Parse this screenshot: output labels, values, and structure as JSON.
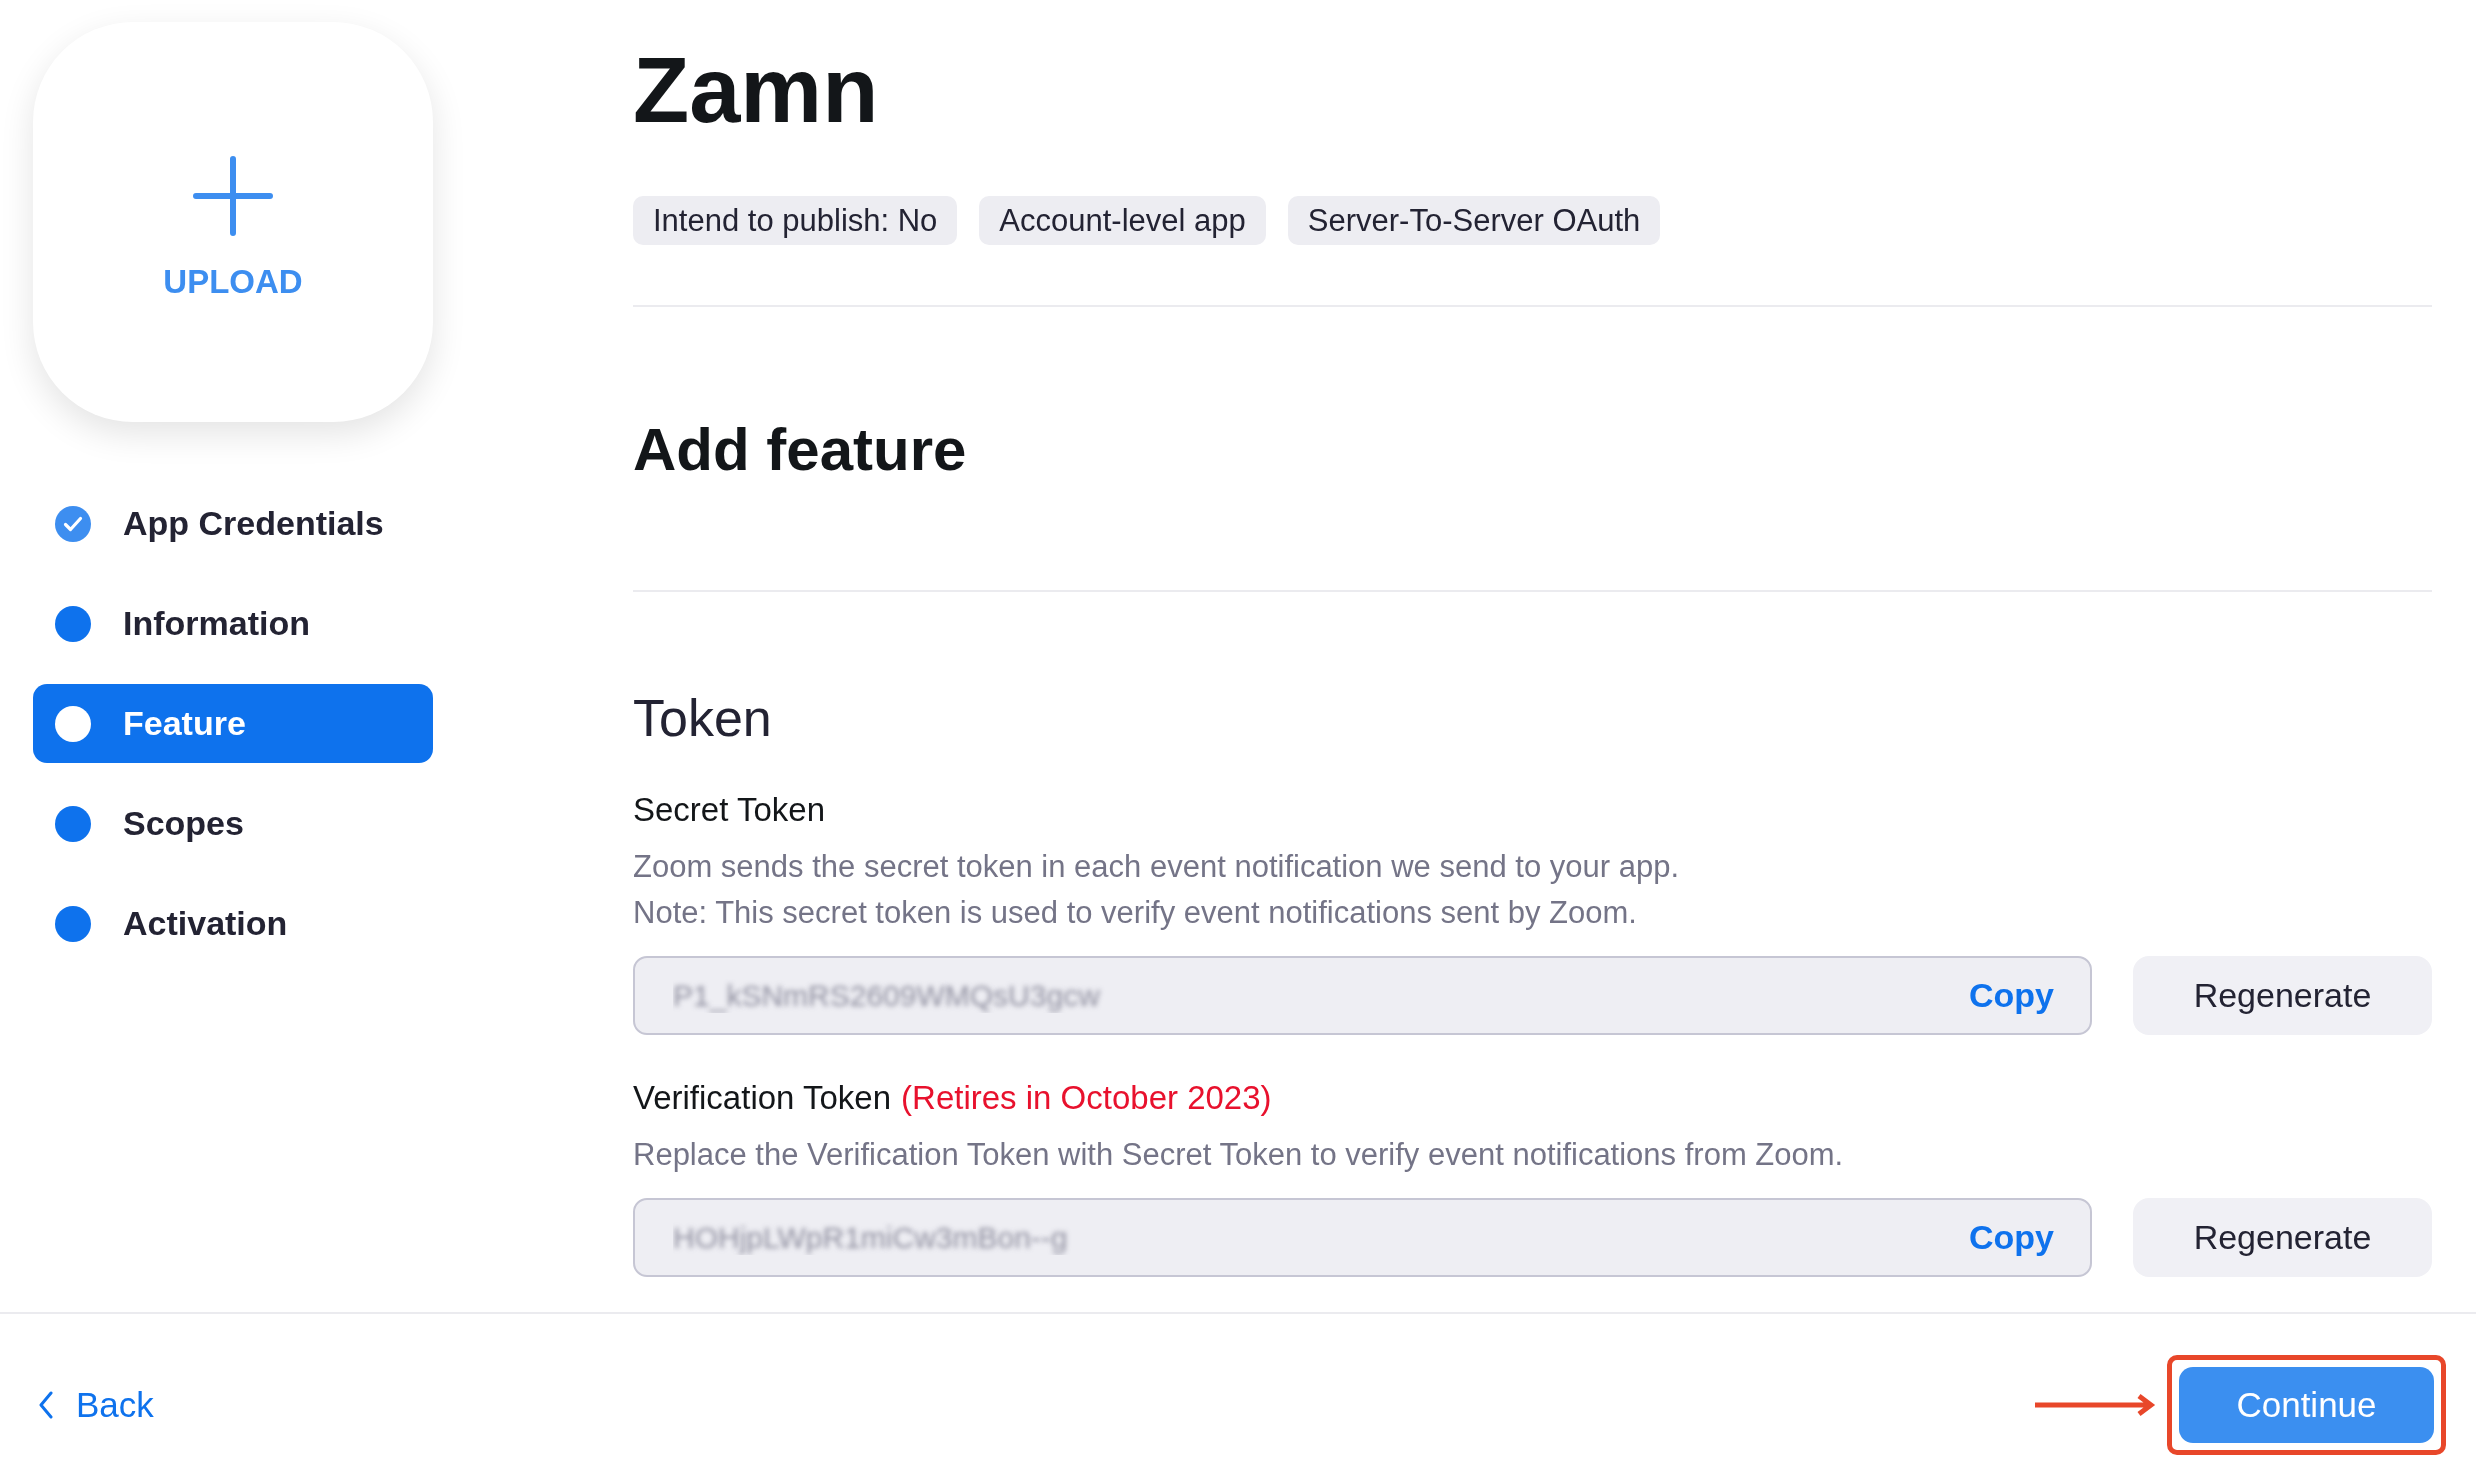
{
  "sidebar": {
    "upload": {
      "label": "UPLOAD"
    },
    "steps": [
      {
        "label": "App Credentials",
        "completed": true,
        "selected": false
      },
      {
        "label": "Information",
        "completed": false,
        "selected": false
      },
      {
        "label": "Feature",
        "completed": false,
        "selected": true
      },
      {
        "label": "Scopes",
        "completed": false,
        "selected": false
      },
      {
        "label": "Activation",
        "completed": false,
        "selected": false
      }
    ]
  },
  "app": {
    "name": "Zamn",
    "tags": [
      "Intend to publish: No",
      "Account-level app",
      "Server-To-Server OAuth"
    ]
  },
  "add_feature": {
    "title": "Add feature"
  },
  "token": {
    "title": "Token",
    "fields": [
      {
        "label": "Secret Token",
        "descriptions": [
          "Zoom sends the secret token in each event notification we send to your app.",
          "Note: This secret token is used to verify event notifications sent by Zoom."
        ],
        "value": "P1_kSNmRS2609WMQsU3gcw",
        "blurred": true,
        "copy_label": "Copy",
        "regenerate_label": "Regenerate"
      },
      {
        "label": "Verification Token",
        "warning": "(Retires in October 2023)",
        "descriptions": [
          "Replace the Verification Token with Secret Token to verify event notifications from Zoom."
        ],
        "value": "HOHjpLWpR1miCw3mBon--g",
        "blurred": true,
        "copy_label": "Copy",
        "regenerate_label": "Regenerate"
      }
    ]
  },
  "footer": {
    "back_label": "Back",
    "continue": {
      "label": "Continue",
      "highlighted": true
    }
  }
}
